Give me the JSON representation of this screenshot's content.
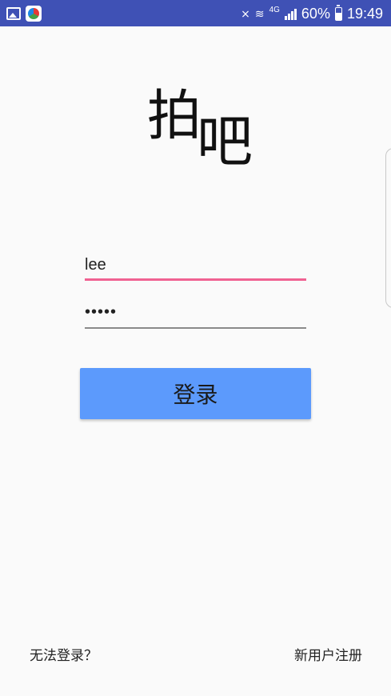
{
  "status_bar": {
    "left_icons": [
      "image-icon",
      "app-icon"
    ],
    "network_label": "4G",
    "battery": "60%",
    "time": "19:49",
    "battery_level": 0.6
  },
  "logo": {
    "char1": "拍",
    "char2": "吧"
  },
  "login_form": {
    "username_value": "lee",
    "password_value": "•••••",
    "login_button": "登录",
    "accent_color": "#f06292",
    "button_color": "#5c9afc"
  },
  "footer": {
    "forgot_link": "无法登录？",
    "register_link": "新用户注册"
  }
}
